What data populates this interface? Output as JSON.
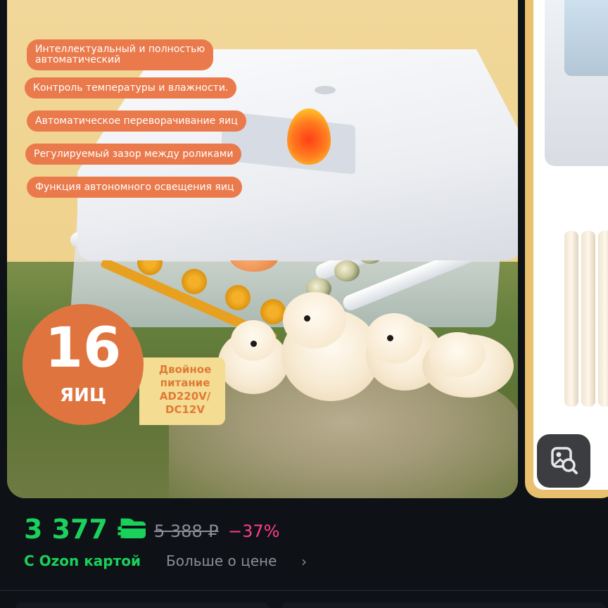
{
  "product_image": {
    "features": [
      "Интеллектуальный и полностью\nавтоматический",
      "Контроль температуры и влажности.",
      "Автоматическое переворачивание яиц",
      "Регулируемый зазор между роликами",
      "Функция автономного освещения яиц"
    ],
    "badge_number": "16",
    "badge_word": "ЯИЦ",
    "power_text": "Двойное питание AD220V/ DC12V"
  },
  "price": {
    "current": "3 377 ₽",
    "old": "5 388 ₽",
    "discount": "−37%",
    "ozon_card_label": "С Ozon картой",
    "more_label": "Больше о цене",
    "chevron": "›",
    "accent_color": "#19d15b",
    "discount_color": "#ff3d8b"
  },
  "icons": {
    "card_icon": "card-icon",
    "lens_icon": "image-search-icon",
    "chevron_icon": "chevron-right-icon"
  }
}
